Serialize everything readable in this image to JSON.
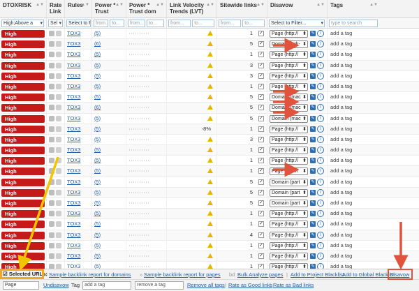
{
  "header": {
    "cols": [
      "DTOXRISK",
      "Rate Link",
      "Rules",
      "Power * Trust",
      "Power * Trust dom",
      "Link Velocity Trends (LVT)",
      "Sitewide links",
      "Disavow",
      "Tags"
    ]
  },
  "filters": {
    "risk": "High;Above a",
    "rate": "Sel",
    "rules": "Select to Fi",
    "pt_from": "from...",
    "pt_to": "to...",
    "ptd_from": "from...",
    "ptd_to": "to...",
    "lvt_from": "from...",
    "lvt_to": "to...",
    "site_from": "from...",
    "site_to": "to...",
    "disavow": "Select to Filter...",
    "tags": "type to search"
  },
  "rows": [
    {
      "risk": "High",
      "rule": "TOX3",
      "num": "(5)",
      "warn": true,
      "lvt": "",
      "count": "1",
      "dis": "Page (http://"
    },
    {
      "risk": "High",
      "rule": "TOX3",
      "num": "(6)",
      "warn": true,
      "lvt": "",
      "count": "5",
      "dis": "Domain (edr-"
    },
    {
      "risk": "High",
      "rule": "TOX3",
      "num": "(5)",
      "warn": true,
      "lvt": "",
      "count": "1",
      "dis": "Page (http://"
    },
    {
      "risk": "High",
      "rule": "TOX3",
      "num": "(5)",
      "warn": true,
      "lvt": "",
      "count": "3",
      "dis": "Page (http://"
    },
    {
      "risk": "High",
      "rule": "TOX3",
      "num": "(5)",
      "warn": true,
      "lvt": "",
      "count": "3",
      "dis": "Page (http://"
    },
    {
      "risk": "High",
      "rule": "TOX3",
      "num": "(5)",
      "warn": true,
      "lvt": "",
      "count": "1",
      "dis": "Page (http://"
    },
    {
      "risk": "High",
      "rule": "TOX3",
      "num": "(5)",
      "warn": true,
      "lvt": "",
      "count": "5",
      "dis": "Domain (mac"
    },
    {
      "risk": "High",
      "rule": "TOX3",
      "num": "(6)",
      "warn": true,
      "lvt": "",
      "count": "5",
      "dis": "Domain (mac"
    },
    {
      "risk": "High",
      "rule": "TOX3",
      "num": "(5)",
      "warn": true,
      "lvt": "",
      "count": "5",
      "dis": "Domain (mac"
    },
    {
      "risk": "High",
      "rule": "TOX3",
      "num": "(5)",
      "warn": false,
      "lvt": "-8%",
      "count": "1",
      "dis": "Page (http://"
    },
    {
      "risk": "High",
      "rule": "TOX3",
      "num": "(5)",
      "warn": true,
      "lvt": "",
      "count": "3",
      "dis": "Page (http://"
    },
    {
      "risk": "High",
      "rule": "TOX3",
      "num": "(5)",
      "warn": true,
      "lvt": "",
      "count": "1",
      "dis": "Page (http://"
    },
    {
      "risk": "High",
      "rule": "TOX3",
      "num": "(5)",
      "warn": true,
      "lvt": "",
      "count": "1",
      "dis": "Page (http://"
    },
    {
      "risk": "High",
      "rule": "TOX3",
      "num": "(5)",
      "warn": true,
      "lvt": "",
      "count": "1",
      "dis": "Page (http://"
    },
    {
      "risk": "High",
      "rule": "TOX3",
      "num": "(5)",
      "warn": true,
      "lvt": "",
      "count": "5",
      "dis": "Domain (part"
    },
    {
      "risk": "High",
      "rule": "TOX3",
      "num": "(5)",
      "warn": true,
      "lvt": "",
      "count": "5",
      "dis": "Domain (part"
    },
    {
      "risk": "High",
      "rule": "TOX3",
      "num": "(5)",
      "warn": true,
      "lvt": "",
      "count": "5",
      "dis": "Domain (part"
    },
    {
      "risk": "High",
      "rule": "TOX3",
      "num": "(5)",
      "warn": true,
      "lvt": "",
      "count": "1",
      "dis": "Page (http://"
    },
    {
      "risk": "High",
      "rule": "TOX3",
      "num": "(5)",
      "warn": true,
      "lvt": "",
      "count": "1",
      "dis": "Page (http://"
    },
    {
      "risk": "High",
      "rule": "TOX3",
      "num": "(5)",
      "warn": true,
      "lvt": "",
      "count": "4",
      "dis": "Page (http://"
    },
    {
      "risk": "High",
      "rule": "TOX3",
      "num": "(5)",
      "warn": true,
      "lvt": "",
      "count": "1",
      "dis": "Page (http://"
    },
    {
      "risk": "High",
      "rule": "TOX3",
      "num": "(5)",
      "warn": true,
      "lvt": "",
      "count": "1",
      "dis": "Page (http://"
    },
    {
      "risk": "High",
      "rule": "TOX3",
      "num": "(5)",
      "warn": true,
      "lvt": "",
      "count": "1",
      "dis": "Page (http://"
    },
    {
      "risk": "High",
      "rule": "SUSP10",
      "num": "(5)",
      "warn": true,
      "lvt": "",
      "count": "1",
      "dis": "Page (http://"
    }
  ],
  "add_tag": "add a tag",
  "footer": {
    "selected": "Selected URLs:",
    "links": [
      "Sample backlink report for domains",
      "Sample backlink report for pages",
      "Bulk Analyze pages",
      "Add to Project Blacklist",
      "Add to Global Blacklist"
    ],
    "disavow": "Disavow",
    "page_select": "Page",
    "undisavow": "Undisavow",
    "tag_label": "Tag",
    "tag_placeholder": "add a tag",
    "remove_placeholder": "remove a tag",
    "remove_all": "Remove all tags",
    "rate_good": "Rate as Good links",
    "rate_bad": "Rate as Bad links"
  },
  "colors": {
    "high_badge": "#c41a1a",
    "link": "#1f5fa6",
    "arrow_red": "#e0533c",
    "arrow_yellow": "#f5c400"
  }
}
